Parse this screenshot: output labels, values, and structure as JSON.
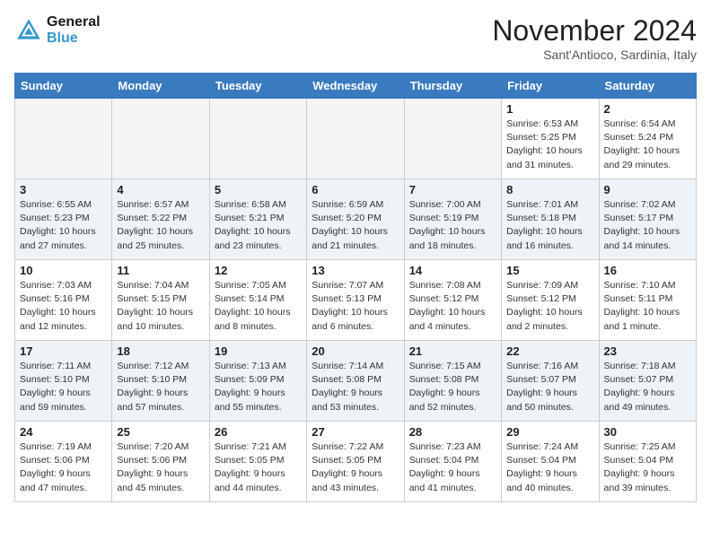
{
  "header": {
    "logo_line1": "General",
    "logo_line2": "Blue",
    "month": "November 2024",
    "location": "Sant'Antioco, Sardinia, Italy"
  },
  "weekdays": [
    "Sunday",
    "Monday",
    "Tuesday",
    "Wednesday",
    "Thursday",
    "Friday",
    "Saturday"
  ],
  "weeks": [
    [
      {
        "day": "",
        "info": ""
      },
      {
        "day": "",
        "info": ""
      },
      {
        "day": "",
        "info": ""
      },
      {
        "day": "",
        "info": ""
      },
      {
        "day": "",
        "info": ""
      },
      {
        "day": "1",
        "info": "Sunrise: 6:53 AM\nSunset: 5:25 PM\nDaylight: 10 hours and 31 minutes."
      },
      {
        "day": "2",
        "info": "Sunrise: 6:54 AM\nSunset: 5:24 PM\nDaylight: 10 hours and 29 minutes."
      }
    ],
    [
      {
        "day": "3",
        "info": "Sunrise: 6:55 AM\nSunset: 5:23 PM\nDaylight: 10 hours and 27 minutes."
      },
      {
        "day": "4",
        "info": "Sunrise: 6:57 AM\nSunset: 5:22 PM\nDaylight: 10 hours and 25 minutes."
      },
      {
        "day": "5",
        "info": "Sunrise: 6:58 AM\nSunset: 5:21 PM\nDaylight: 10 hours and 23 minutes."
      },
      {
        "day": "6",
        "info": "Sunrise: 6:59 AM\nSunset: 5:20 PM\nDaylight: 10 hours and 21 minutes."
      },
      {
        "day": "7",
        "info": "Sunrise: 7:00 AM\nSunset: 5:19 PM\nDaylight: 10 hours and 18 minutes."
      },
      {
        "day": "8",
        "info": "Sunrise: 7:01 AM\nSunset: 5:18 PM\nDaylight: 10 hours and 16 minutes."
      },
      {
        "day": "9",
        "info": "Sunrise: 7:02 AM\nSunset: 5:17 PM\nDaylight: 10 hours and 14 minutes."
      }
    ],
    [
      {
        "day": "10",
        "info": "Sunrise: 7:03 AM\nSunset: 5:16 PM\nDaylight: 10 hours and 12 minutes."
      },
      {
        "day": "11",
        "info": "Sunrise: 7:04 AM\nSunset: 5:15 PM\nDaylight: 10 hours and 10 minutes."
      },
      {
        "day": "12",
        "info": "Sunrise: 7:05 AM\nSunset: 5:14 PM\nDaylight: 10 hours and 8 minutes."
      },
      {
        "day": "13",
        "info": "Sunrise: 7:07 AM\nSunset: 5:13 PM\nDaylight: 10 hours and 6 minutes."
      },
      {
        "day": "14",
        "info": "Sunrise: 7:08 AM\nSunset: 5:12 PM\nDaylight: 10 hours and 4 minutes."
      },
      {
        "day": "15",
        "info": "Sunrise: 7:09 AM\nSunset: 5:12 PM\nDaylight: 10 hours and 2 minutes."
      },
      {
        "day": "16",
        "info": "Sunrise: 7:10 AM\nSunset: 5:11 PM\nDaylight: 10 hours and 1 minute."
      }
    ],
    [
      {
        "day": "17",
        "info": "Sunrise: 7:11 AM\nSunset: 5:10 PM\nDaylight: 9 hours and 59 minutes."
      },
      {
        "day": "18",
        "info": "Sunrise: 7:12 AM\nSunset: 5:10 PM\nDaylight: 9 hours and 57 minutes."
      },
      {
        "day": "19",
        "info": "Sunrise: 7:13 AM\nSunset: 5:09 PM\nDaylight: 9 hours and 55 minutes."
      },
      {
        "day": "20",
        "info": "Sunrise: 7:14 AM\nSunset: 5:08 PM\nDaylight: 9 hours and 53 minutes."
      },
      {
        "day": "21",
        "info": "Sunrise: 7:15 AM\nSunset: 5:08 PM\nDaylight: 9 hours and 52 minutes."
      },
      {
        "day": "22",
        "info": "Sunrise: 7:16 AM\nSunset: 5:07 PM\nDaylight: 9 hours and 50 minutes."
      },
      {
        "day": "23",
        "info": "Sunrise: 7:18 AM\nSunset: 5:07 PM\nDaylight: 9 hours and 49 minutes."
      }
    ],
    [
      {
        "day": "24",
        "info": "Sunrise: 7:19 AM\nSunset: 5:06 PM\nDaylight: 9 hours and 47 minutes."
      },
      {
        "day": "25",
        "info": "Sunrise: 7:20 AM\nSunset: 5:06 PM\nDaylight: 9 hours and 45 minutes."
      },
      {
        "day": "26",
        "info": "Sunrise: 7:21 AM\nSunset: 5:05 PM\nDaylight: 9 hours and 44 minutes."
      },
      {
        "day": "27",
        "info": "Sunrise: 7:22 AM\nSunset: 5:05 PM\nDaylight: 9 hours and 43 minutes."
      },
      {
        "day": "28",
        "info": "Sunrise: 7:23 AM\nSunset: 5:04 PM\nDaylight: 9 hours and 41 minutes."
      },
      {
        "day": "29",
        "info": "Sunrise: 7:24 AM\nSunset: 5:04 PM\nDaylight: 9 hours and 40 minutes."
      },
      {
        "day": "30",
        "info": "Sunrise: 7:25 AM\nSunset: 5:04 PM\nDaylight: 9 hours and 39 minutes."
      }
    ]
  ]
}
